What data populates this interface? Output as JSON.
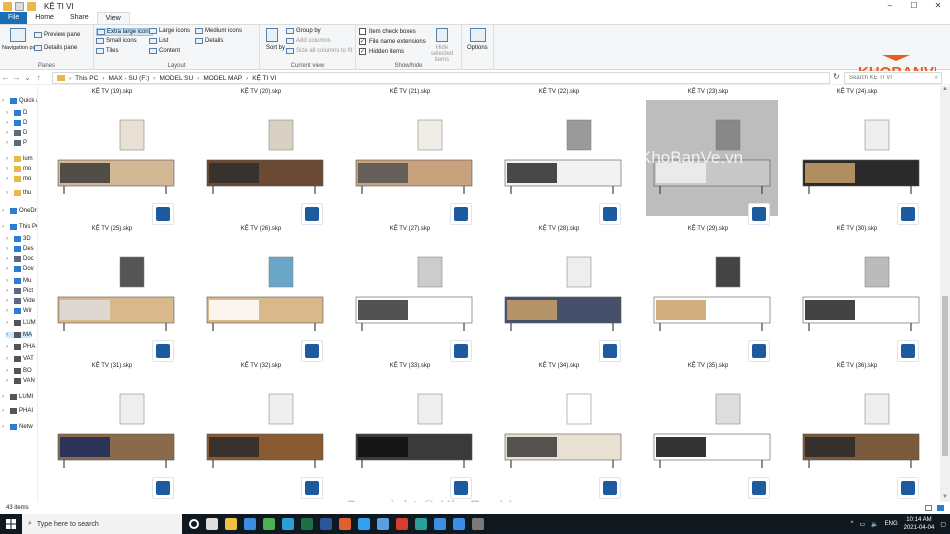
{
  "window": {
    "title": "KỆ TI VI",
    "controls": [
      "–",
      "☐",
      "✕"
    ]
  },
  "tabs": [
    {
      "label": "File"
    },
    {
      "label": "Home"
    },
    {
      "label": "Share"
    },
    {
      "label": "View"
    }
  ],
  "ribbon": {
    "panes": {
      "navigation_pane": "Navigation pane",
      "preview_pane": "Preview pane",
      "details_pane": "Details pane",
      "group": "Panes"
    },
    "layout": {
      "extra_large": "Extra large icons",
      "large": "Large icons",
      "medium": "Medium icons",
      "small": "Small icons",
      "list": "List",
      "details": "Details",
      "tiles": "Tiles",
      "content": "Content",
      "group": "Layout"
    },
    "current_view": {
      "sort_by": "Sort by",
      "group_by": "Group by",
      "add_columns": "Add columns",
      "size_columns": "Size all columns to fit",
      "group": "Current view"
    },
    "show_hide": {
      "item_check_boxes": "Item check boxes",
      "file_name_extensions": "File name extensions",
      "hidden_items": "Hidden items",
      "hide_selected": "Hide selected items",
      "group": "Show/hide"
    },
    "options": "Options",
    "checks": {
      "item_check_boxes": false,
      "file_name_extensions": true,
      "hidden_items": true
    }
  },
  "logo_text": "KHOBANVE",
  "address": {
    "crumbs": [
      "This PC",
      "MAX - SU (F:)",
      "MODEL SU",
      "MODEL MAP",
      "KỆ TI VI"
    ],
    "search_placeholder": "Search KỆ TI VI"
  },
  "nav": [
    {
      "label": "Quick access",
      "icon": "star-icon",
      "color": "#2b7cd3"
    },
    {
      "label": "D",
      "icon": "desktop-icon",
      "color": "#2b7cd3"
    },
    {
      "label": "D",
      "icon": "download-icon",
      "color": "#2b7cd3"
    },
    {
      "label": "D",
      "icon": "documents-icon",
      "color": "#5a6b7d"
    },
    {
      "label": "P",
      "icon": "pictures-icon",
      "color": "#5a6b7d"
    },
    {
      "label": "lum",
      "icon": "folder-icon",
      "color": "#e8b84a"
    },
    {
      "label": "mo",
      "icon": "folder-icon",
      "color": "#e8b84a"
    },
    {
      "label": "mo",
      "icon": "folder-icon",
      "color": "#e8b84a"
    },
    {
      "label": "thu",
      "icon": "folder-icon",
      "color": "#e8b84a"
    },
    {
      "label": "OneDrive",
      "icon": "cloud-icon",
      "color": "#2b7cd3"
    },
    {
      "label": "This PC",
      "icon": "pc-icon",
      "color": "#2b7cd3"
    },
    {
      "label": "3D",
      "icon": "3d-objects-icon",
      "color": "#2b7cd3"
    },
    {
      "label": "Des",
      "icon": "desktop-icon",
      "color": "#2b7cd3"
    },
    {
      "label": "Doc",
      "icon": "documents-icon",
      "color": "#5a6b7d"
    },
    {
      "label": "Dov",
      "icon": "download-icon",
      "color": "#2b7cd3"
    },
    {
      "label": "Mu",
      "icon": "music-icon",
      "color": "#2b7cd3"
    },
    {
      "label": "Pict",
      "icon": "pictures-icon",
      "color": "#5a6b7d"
    },
    {
      "label": "Vide",
      "icon": "video-icon",
      "color": "#5a6b7d"
    },
    {
      "label": "Wir",
      "icon": "drive-icon",
      "color": "#2b7cd3"
    },
    {
      "label": "LUM",
      "icon": "drive-icon",
      "color": "#555"
    },
    {
      "label": "MA",
      "icon": "drive-icon",
      "color": "#555",
      "selected": true
    },
    {
      "label": "PHA",
      "icon": "drive-icon",
      "color": "#555"
    },
    {
      "label": "VAT",
      "icon": "drive-icon",
      "color": "#555"
    },
    {
      "label": "BO",
      "icon": "drive-icon",
      "color": "#555"
    },
    {
      "label": "VAN",
      "icon": "drive-icon",
      "color": "#555"
    },
    {
      "label": "LUMI",
      "icon": "drive-icon",
      "color": "#555"
    },
    {
      "label": "PHAI",
      "icon": "drive-icon",
      "color": "#555"
    },
    {
      "label": "Netw",
      "icon": "network-icon",
      "color": "#2b7cd3"
    }
  ],
  "files_top_labels": [
    "KỆ TV (19).skp",
    "KỆ TV (20).skp",
    "KỆ TV (21).skp",
    "KỆ TV (22).skp",
    "KỆ TV (23).skp",
    "KỆ TV (24).skp"
  ],
  "files": [
    {
      "label": "KỆ TV (25).skp"
    },
    {
      "label": "KỆ TV (26).skp"
    },
    {
      "label": "KỆ TV (27).skp"
    },
    {
      "label": "KỆ TV (28).skp"
    },
    {
      "label": "KỆ TV (29).skp"
    },
    {
      "label": "KỆ TV (30).skp"
    },
    {
      "label": "KỆ TV (31).skp"
    },
    {
      "label": "KỆ TV (32).skp"
    },
    {
      "label": "KỆ TV (33).skp"
    },
    {
      "label": "KỆ TV (34).skp"
    },
    {
      "label": "KỆ TV (35).skp"
    },
    {
      "label": "KỆ TV (36).skp"
    }
  ],
  "status": {
    "items": "43 items"
  },
  "taskbar": {
    "search": "Type here to search",
    "lang": "ENG",
    "time": "10:14 AM",
    "date": "2021-04-04",
    "apps": [
      {
        "icon": "task-view-icon",
        "color": "#dddddd"
      },
      {
        "icon": "file-explorer-icon",
        "color": "#f0c040"
      },
      {
        "icon": "store-icon",
        "color": "#3a8ee6"
      },
      {
        "icon": "chrome-icon",
        "color": "#4caf50"
      },
      {
        "icon": "edge-icon",
        "color": "#2a9fd6"
      },
      {
        "icon": "excel-icon",
        "color": "#1d7044"
      },
      {
        "icon": "word-icon",
        "color": "#2b579a"
      },
      {
        "icon": "app-icon",
        "color": "#e06030"
      },
      {
        "icon": "photoshop-icon",
        "color": "#2fa3f2"
      },
      {
        "icon": "app-icon",
        "color": "#5aa0e0"
      },
      {
        "icon": "sketchup-icon",
        "color": "#d83c2c"
      },
      {
        "icon": "3ds-icon",
        "color": "#2aa198"
      },
      {
        "icon": "app-icon",
        "color": "#3a8ee6"
      },
      {
        "icon": "zalo-icon",
        "color": "#3a8ee6"
      },
      {
        "icon": "app-icon",
        "color": "#7a7a7a"
      }
    ]
  },
  "watermark": "Copyright © KhoBanVe.vn",
  "watermark2": "KhoBanVe.vn"
}
